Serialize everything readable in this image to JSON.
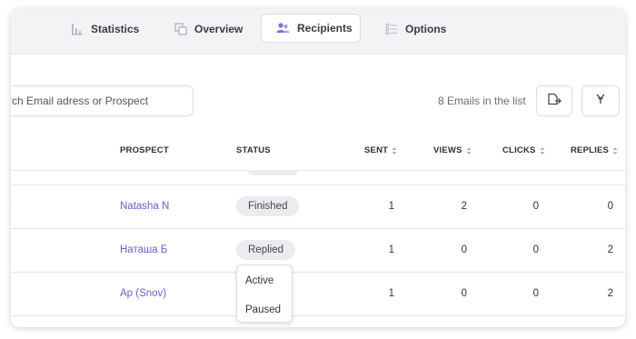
{
  "tabs": [
    {
      "label": "Statistics",
      "icon": "bar-chart-icon"
    },
    {
      "label": "Overview",
      "icon": "overview-icon"
    },
    {
      "label": "Recipients",
      "icon": "users-icon",
      "active": true
    },
    {
      "label": "Options",
      "icon": "list-icon"
    }
  ],
  "search": {
    "placeholder": "rch Email adress or Prospect"
  },
  "list_count": "8 Emails in the list",
  "toolbar": {
    "export_icon": "export-icon",
    "filter_icon": "filter-icon"
  },
  "columns": {
    "prospect": "PROSPECT",
    "status": "STATUS",
    "sent": "SENT",
    "views": "VIEWS",
    "clicks": "CLICKS",
    "replies": "REPLIES"
  },
  "rows": [
    {
      "edge": "ı",
      "prospect": "Natasha N",
      "status": "Finished",
      "sent": "1",
      "views": "2",
      "clicks": "0",
      "replies": "0"
    },
    {
      "edge": "",
      "prospect": "Наташа Б",
      "status": "Replied",
      "sent": "1",
      "views": "0",
      "clicks": "0",
      "replies": "2"
    },
    {
      "edge": "",
      "prospect": "Ap (Snov)",
      "status": "",
      "sent": "1",
      "views": "0",
      "clicks": "0",
      "replies": "2"
    }
  ],
  "status_dropdown": {
    "options": [
      "Active",
      "Paused"
    ]
  },
  "colors": {
    "accent": "#6b60c9",
    "pill_bg": "#ececf0",
    "tabbar_bg": "#f3f3f6",
    "border": "#dcdce4"
  }
}
